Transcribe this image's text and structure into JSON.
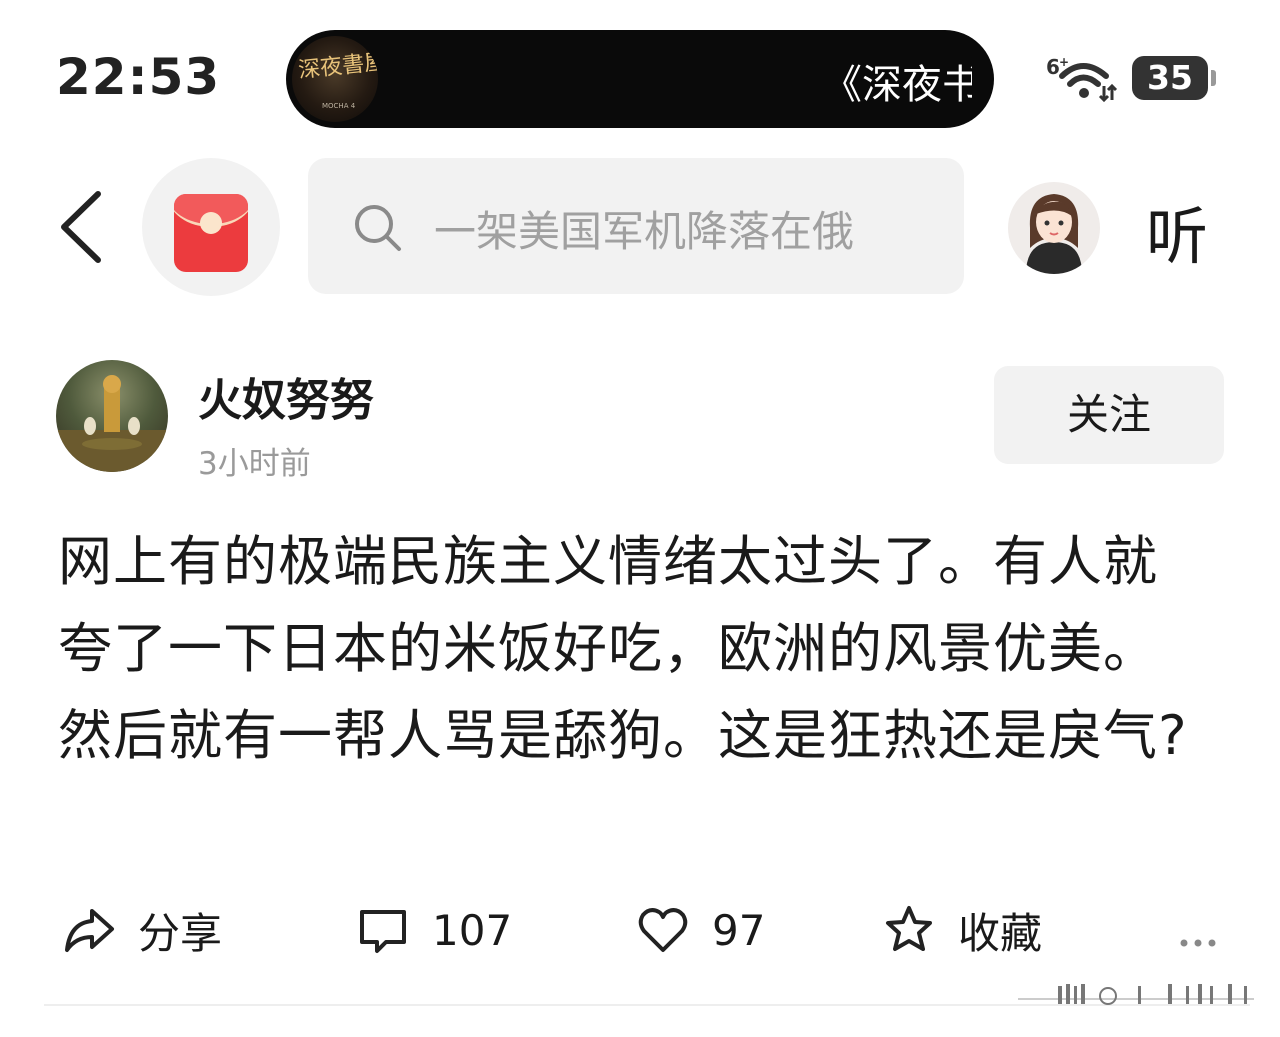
{
  "status_bar": {
    "time": "22:53",
    "now_playing": {
      "album_title": "深夜書屋",
      "album_sub": "MOCHA 4",
      "text": "《深夜书"
    },
    "network": "6",
    "battery": "35"
  },
  "nav": {
    "search_placeholder": "一架美国军机降落在俄",
    "listen_label": "听"
  },
  "author": {
    "name": "火奴努努",
    "time": "3小时前",
    "follow_label": "关注"
  },
  "post": {
    "text": "网上有的极端民族主义情绪太过头了。有人就夸了一下日本的米饭好吃，欧洲的风景优美。然后就有一帮人骂是舔狗。这是狂热还是戾气?"
  },
  "actions": {
    "share_label": "分享",
    "comments": "107",
    "likes": "97",
    "favorite_label": "收藏"
  },
  "colors": {
    "accent_red": "#ec3b3e",
    "text_primary": "#1a1a1a",
    "text_secondary": "#9a9a9a",
    "chip_bg": "#f2f2f2"
  }
}
